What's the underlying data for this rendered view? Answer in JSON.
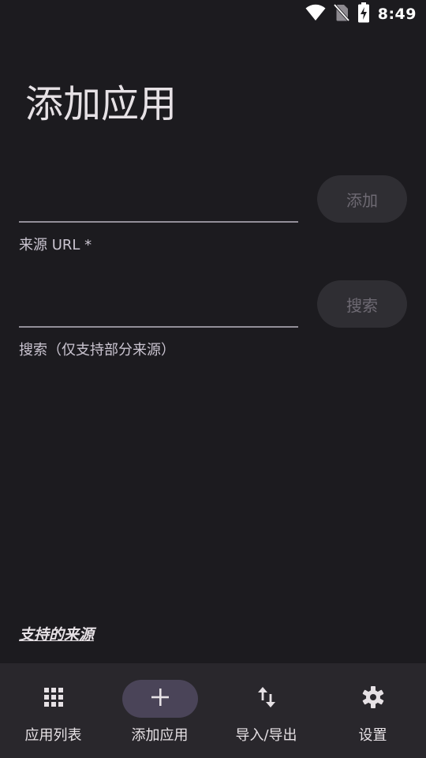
{
  "status_bar": {
    "time": "8:49",
    "icons": [
      "wifi-icon",
      "no-sim-icon",
      "battery-charging-icon"
    ]
  },
  "page": {
    "title": "添加应用"
  },
  "source_url": {
    "value": "",
    "label": "来源 URL *",
    "button_label": "添加"
  },
  "search": {
    "value": "",
    "label": "搜索（仅支持部分来源）",
    "button_label": "搜索"
  },
  "supported_sources_link": "支持的来源",
  "bottom_nav": {
    "items": [
      {
        "label": "应用列表",
        "icon": "grid-icon",
        "active": false
      },
      {
        "label": "添加应用",
        "icon": "plus-icon",
        "active": true
      },
      {
        "label": "导入/导出",
        "icon": "swap-vertical-icon",
        "active": false
      },
      {
        "label": "设置",
        "icon": "gear-icon",
        "active": false
      }
    ]
  },
  "colors": {
    "background": "#1c1b1f",
    "nav_background": "#29272c",
    "active_indicator": "#4a4458",
    "disabled_button": "#2f2e33",
    "text_primary": "#e6e1e5"
  }
}
